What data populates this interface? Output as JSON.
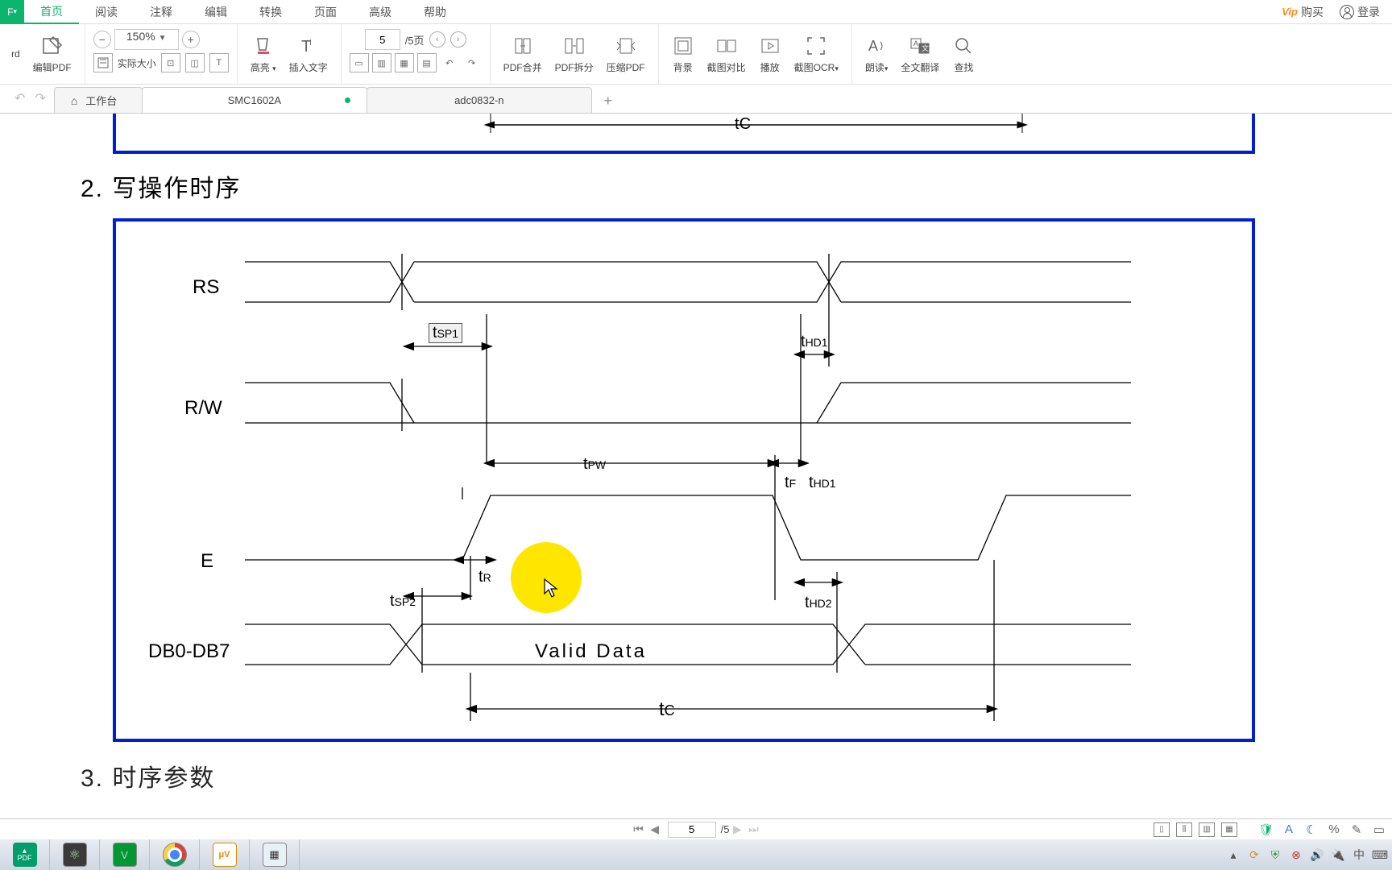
{
  "menu": {
    "corner": "F",
    "items": [
      "首页",
      "阅读",
      "注释",
      "编辑",
      "转换",
      "页面",
      "高级",
      "帮助"
    ],
    "active_index": 0,
    "vip_prefix": "Vip",
    "buy": "购买",
    "login": "登录"
  },
  "toolbar": {
    "left_trunc": "rd",
    "edit_pdf": "编辑PDF",
    "zoom_value": "150%",
    "actual_size": "实际大小",
    "highlight": "高亮",
    "insert_text": "插入文字",
    "page_current": "5",
    "page_total": "/5页",
    "pdf_merge": "PDF合并",
    "pdf_split": "PDF拆分",
    "pdf_compress": "压缩PDF",
    "background": "背景",
    "screenshot_compare": "截图对比",
    "play": "播放",
    "ocr": "截图OCR",
    "read_aloud": "朗读",
    "full_translate": "全文翻译",
    "find": "查找"
  },
  "tabs": {
    "home": "工作台",
    "items": [
      {
        "label": "SMC1602A",
        "modified": true,
        "active": true
      },
      {
        "label": "adc0832-n",
        "modified": false,
        "active": false
      }
    ]
  },
  "document": {
    "top_label_tc": "tC",
    "section_number": "2.",
    "section_title": "写操作时序",
    "signals": {
      "rs": "RS",
      "rw": "R/W",
      "e": "E",
      "db": "DB0-DB7"
    },
    "timing_labels": {
      "tsp1": "tSP1",
      "thd1": "tHD1",
      "tpw": "tPW",
      "tf": "tF",
      "thd1_2": "tHD1",
      "tr": "tR",
      "tsp2": "tSP2",
      "thd2": "tHD2",
      "valid_data": "Valid Data",
      "tc": "tC"
    },
    "next_section_number": "3.",
    "next_section_title": "时序参数"
  },
  "statusbar": {
    "page_current": "5",
    "page_total": "/5"
  },
  "taskbar": {
    "items": [
      "pdf",
      "atom",
      "vim",
      "chrome",
      "labview",
      "calc"
    ],
    "tray": [
      "up",
      "sync",
      "shield",
      "close-red",
      "volume",
      "power",
      "ime",
      "keyboard"
    ]
  },
  "colors": {
    "accent": "#0cb56e",
    "diagram_border": "#0020d0",
    "highlight": "#ffe600"
  }
}
